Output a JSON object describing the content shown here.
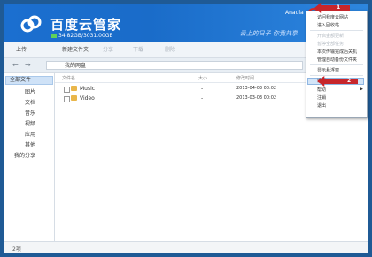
{
  "app": {
    "brand": "百度云管家",
    "quota": "34.82GB/3031.00GB",
    "slogan": "云上的日子 你我共享",
    "user": "Anaula"
  },
  "toolbar": {
    "items": [
      "上传",
      "新建文件夹",
      "分享",
      "下载",
      "删除"
    ]
  },
  "addressbar": {
    "path": "我的网盘"
  },
  "sidebar": {
    "items": [
      "全部文件",
      "图片",
      "文档",
      "音乐",
      "视频",
      "应用",
      "其他",
      "我的分享"
    ]
  },
  "table": {
    "headers": [
      "文件名",
      "大小",
      "修改时间"
    ],
    "rows": [
      {
        "name": "Music",
        "size": "-",
        "time": "2013-04-03 00:02"
      },
      {
        "name": "Video",
        "size": "-",
        "time": "2013-03-03 00:02"
      }
    ]
  },
  "status": {
    "text": "2项"
  },
  "menu": {
    "items": [
      "访问我度云网站",
      "进入回收站",
      "开启金额更新",
      "暂停全部任务",
      "本次传输完成后关机",
      "管理自动备份文件夹",
      "显示悬浮窗",
      "设置",
      "帮助",
      "注销",
      "退出"
    ],
    "highlighted": "设置"
  },
  "annotations": {
    "badge_1": "1",
    "badge_2": "2"
  },
  "colors": {
    "accent": "#1b6fd0",
    "arrow": "#c7262b"
  }
}
